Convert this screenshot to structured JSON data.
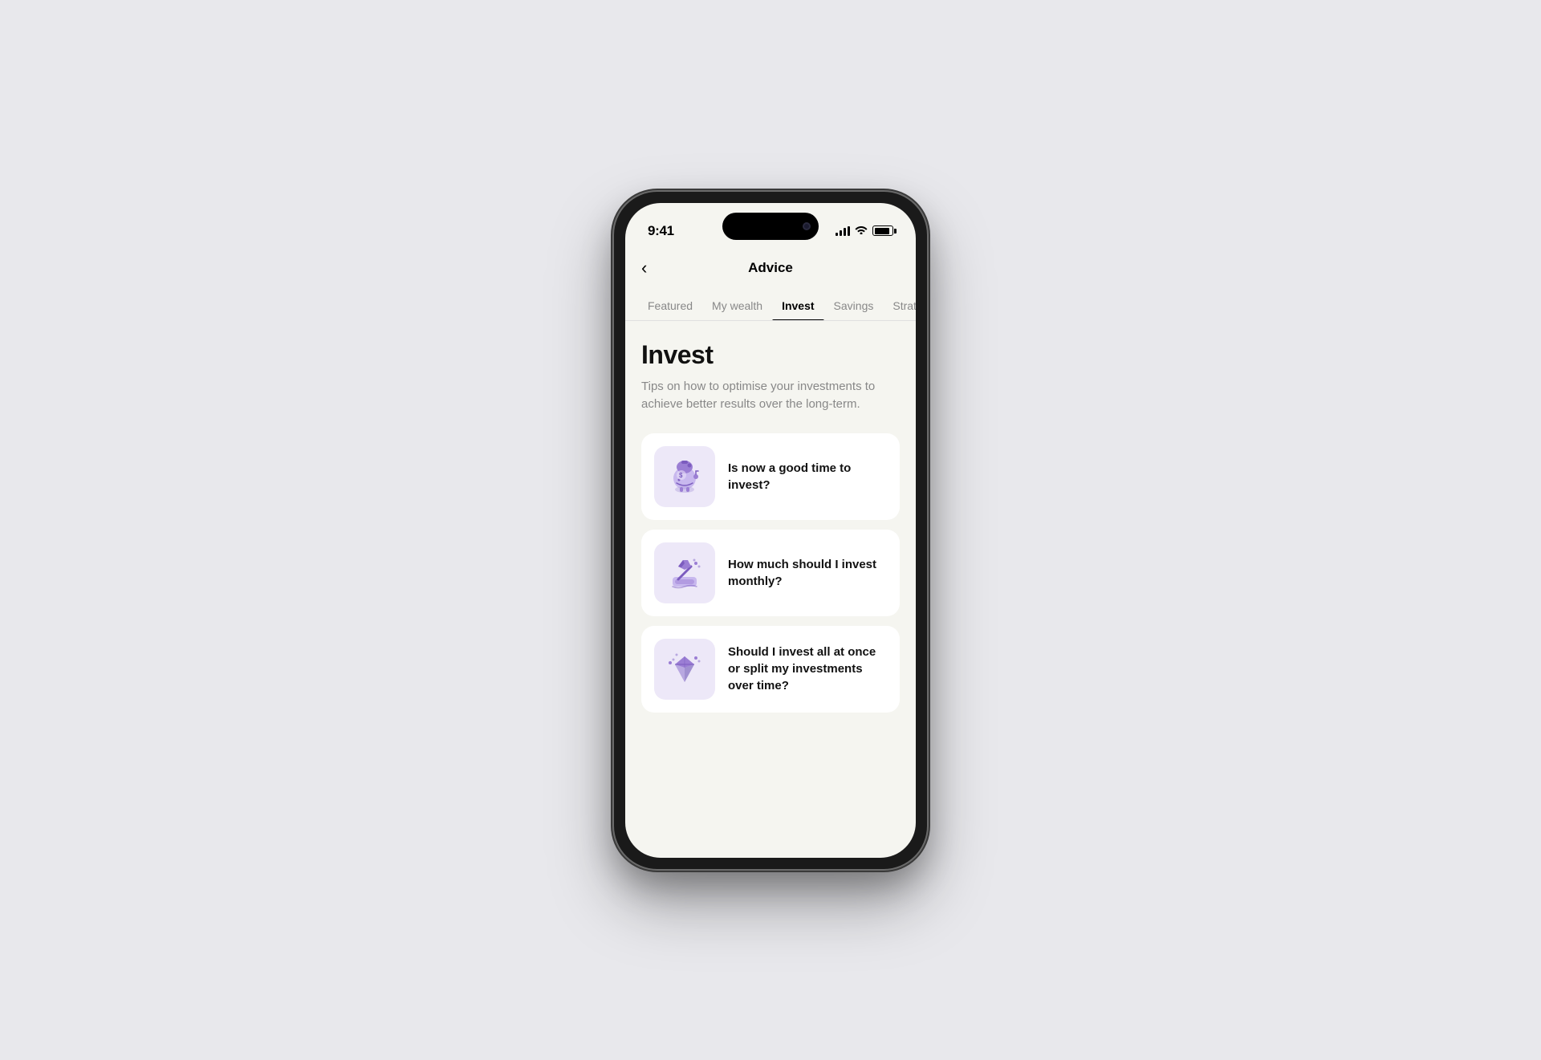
{
  "statusBar": {
    "time": "9:41",
    "signal": "signal",
    "wifi": "wifi",
    "battery": "battery"
  },
  "header": {
    "title": "Advice",
    "backLabel": "‹"
  },
  "tabs": [
    {
      "id": "featured",
      "label": "Featured",
      "active": false
    },
    {
      "id": "my-wealth",
      "label": "My wealth",
      "active": false
    },
    {
      "id": "invest",
      "label": "Invest",
      "active": true
    },
    {
      "id": "savings",
      "label": "Savings",
      "active": false
    },
    {
      "id": "strategy",
      "label": "Strategy",
      "active": false
    }
  ],
  "section": {
    "title": "Invest",
    "description": "Tips on how to optimise your investments to achieve better results over the long-term."
  },
  "articles": [
    {
      "id": "article-1",
      "title": "Is now a good time to invest?",
      "iconType": "piggy-bank"
    },
    {
      "id": "article-2",
      "title": "How much should I invest monthly?",
      "iconType": "pickaxe"
    },
    {
      "id": "article-3",
      "title": "Should I invest all at once or split my investments over time?",
      "iconType": "diamond"
    }
  ],
  "colors": {
    "accent": "#7c5cbf",
    "iconBg": "#ede8f8",
    "activeTab": "#000000"
  }
}
